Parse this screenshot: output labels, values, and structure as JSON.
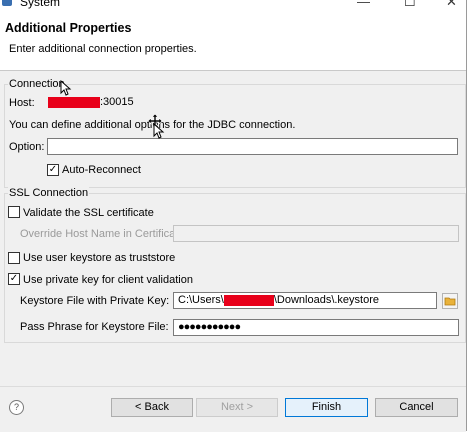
{
  "window": {
    "title": "System"
  },
  "header": {
    "title": "Additional Properties",
    "description": "Enter additional connection properties."
  },
  "connection": {
    "group_title": "Connection",
    "host_label": "Host:",
    "host_value_suffix": ":30015",
    "info_text": "You can define additional options for the JDBC connection.",
    "option_label": "Option:",
    "option_value": "",
    "auto_reconnect_label": "Auto-Reconnect",
    "auto_reconnect_checked": true
  },
  "ssl": {
    "group_title": "SSL Connection",
    "validate_cert_label": "Validate the SSL certificate",
    "validate_cert_checked": false,
    "override_host_label": "Override Host Name in Certificate:",
    "override_host_value": "",
    "user_keystore_label": "Use user keystore as truststore",
    "user_keystore_checked": false,
    "private_key_label": "Use private key for client validation",
    "private_key_checked": true,
    "keystore_file_label": "Keystore File with Private Key:",
    "keystore_file_prefix": "C:\\Users\\",
    "keystore_file_suffix": "\\Downloads\\.keystore",
    "passphrase_label": "Pass Phrase for Keystore File:",
    "passphrase_value": "●●●●●●●●●●●"
  },
  "footer": {
    "help_icon": "help-icon",
    "back_label": "< Back",
    "next_label": "Next >",
    "finish_label": "Finish",
    "cancel_label": "Cancel"
  },
  "colors": {
    "redaction": "#e8001a",
    "accent": "#0078d7"
  }
}
